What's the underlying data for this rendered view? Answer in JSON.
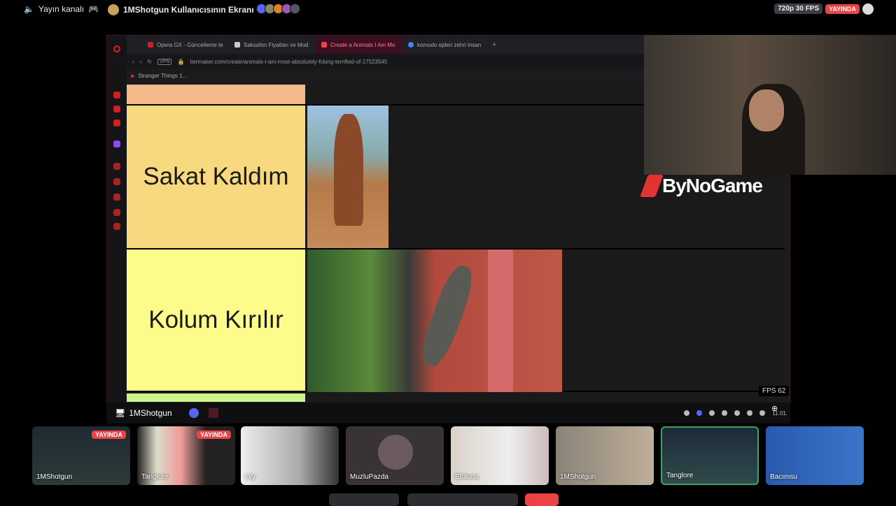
{
  "topbar": {
    "channel": "Yayın kanalı",
    "title": "1MShotgun Kullanıcısının Ekranı",
    "quality": "720p 30 FPS",
    "live": "YAYINDA"
  },
  "browser": {
    "tabs": [
      {
        "label": "Opera GX - Güncelleme te"
      },
      {
        "label": "Saksafon Fiyatları ve Mod"
      },
      {
        "label": "Create a Animals I Am Mo"
      },
      {
        "label": "komodo ejderi zehri insan"
      }
    ],
    "url": "tiermaker.com/create/animals-i-am-most-absolutely-fcking-terrified-of-17523545",
    "vpn": "VPN",
    "bookmark": "Stranger Things 1..."
  },
  "tierlist": {
    "rows": [
      {
        "label": "Sakat Kaldım"
      },
      {
        "label": "Kolum Kırılır"
      }
    ]
  },
  "overlay": {
    "logo": "ByNoGame",
    "fps": "FPS 62"
  },
  "footer": {
    "streamer": "1MShotgun",
    "date": "11.01."
  },
  "participants": [
    {
      "name": "1MShotgun",
      "live": "YAYINDA"
    },
    {
      "name": "Tanglore",
      "live": "YAYINDA"
    },
    {
      "name": "Lily"
    },
    {
      "name": "MuzluPazda"
    },
    {
      "name": "Efoluna"
    },
    {
      "name": "1MShotgun"
    },
    {
      "name": "Tanglore"
    },
    {
      "name": "Bacımsu"
    }
  ],
  "colors": {
    "live": "#ed4245",
    "tier_s": "#f5b98a",
    "tier_a": "#f9d97f",
    "tier_b": "#fcfc8a",
    "selected": "#3ba55c"
  }
}
